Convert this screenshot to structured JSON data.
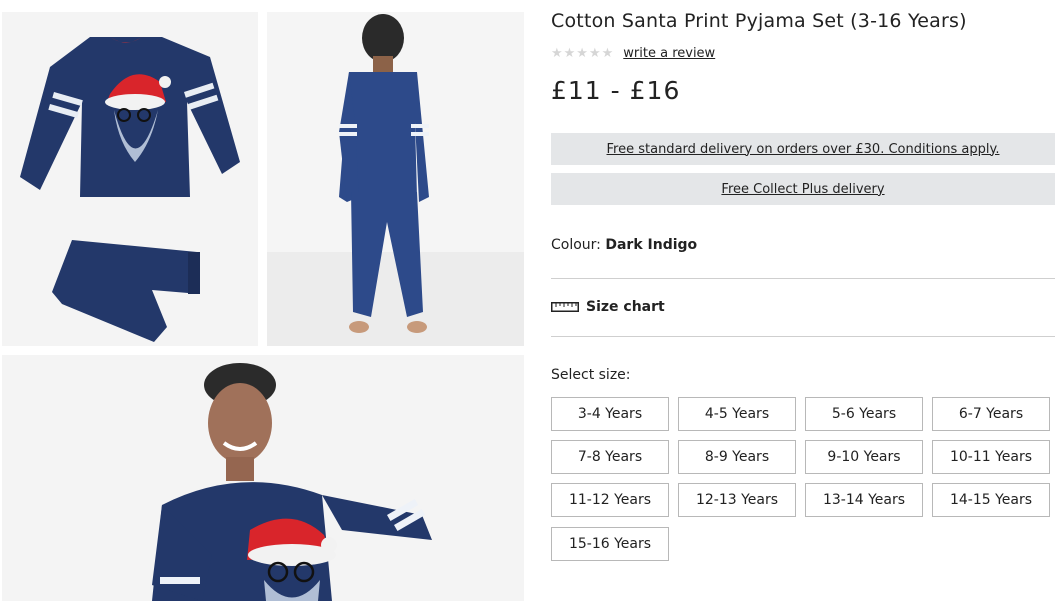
{
  "product": {
    "title": "Cotton Santa Print Pyjama Set (3-16 Years)",
    "stars": "★★★★★",
    "review_link": "write a review",
    "price": "£11 - £16"
  },
  "delivery": {
    "standard": "Free standard delivery on orders over £30. Conditions apply.",
    "collect": "Free Collect Plus delivery"
  },
  "colour": {
    "label": "Colour:",
    "value": "Dark Indigo"
  },
  "size_chart": {
    "label": "Size chart",
    "icon": "ruler-icon"
  },
  "sizes": {
    "label": "Select size:",
    "options": [
      "3-4 Years",
      "4-5 Years",
      "5-6 Years",
      "6-7 Years",
      "7-8 Years",
      "8-9 Years",
      "9-10 Years",
      "10-11 Years",
      "11-12 Years",
      "12-13 Years",
      "13-14 Years",
      "14-15 Years",
      "15-16 Years"
    ]
  },
  "colors": {
    "garment": "#23386a",
    "delivery_bg": "#e4e6e8",
    "santa_hat": "#d9252b"
  }
}
